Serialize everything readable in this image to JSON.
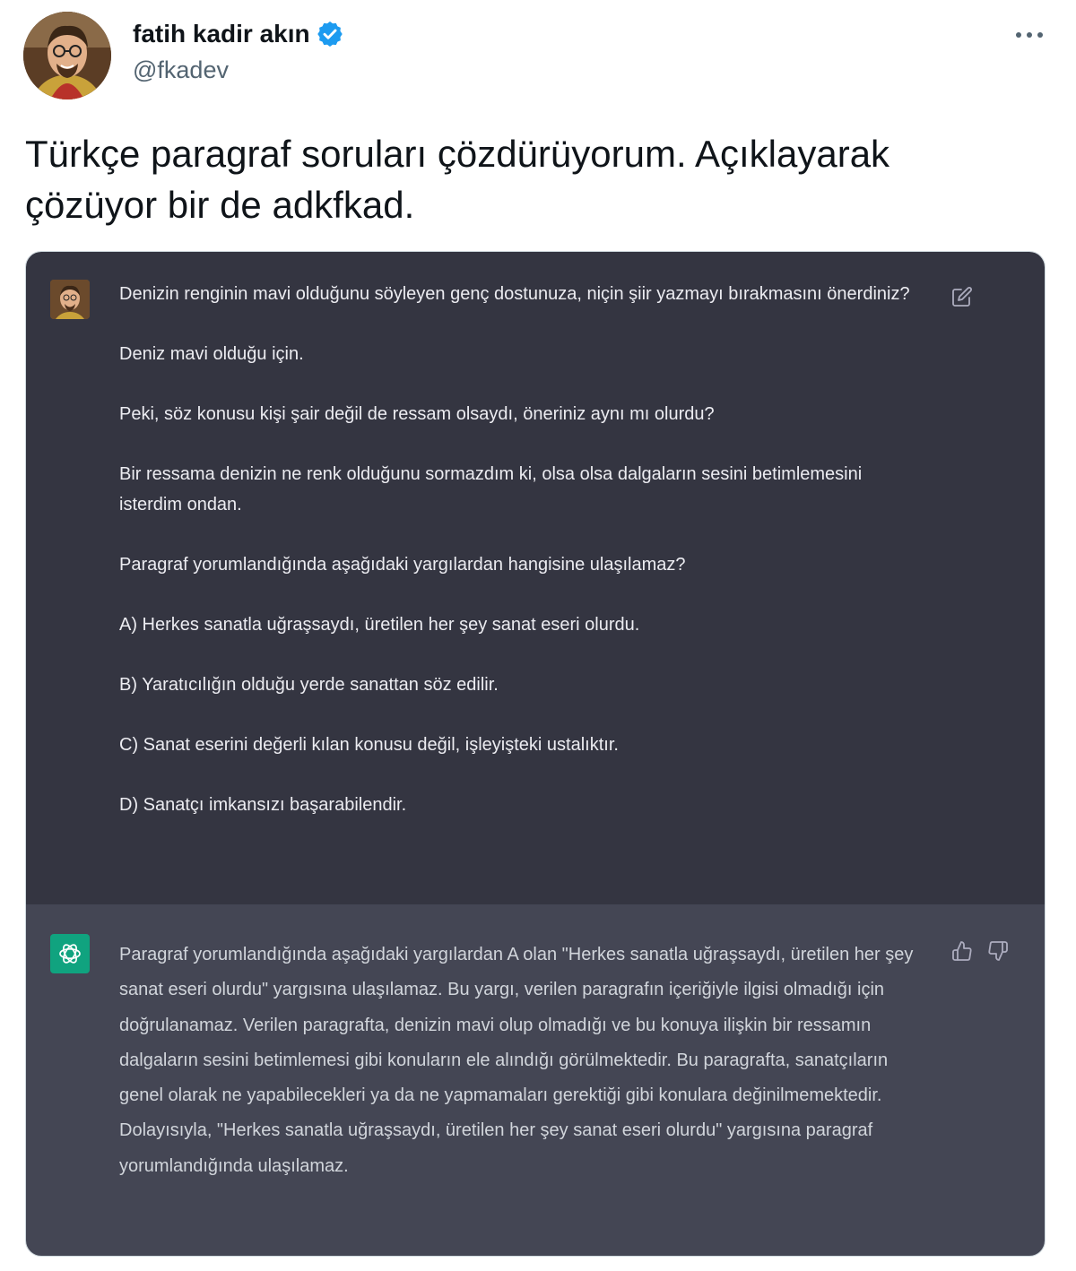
{
  "tweet": {
    "author": {
      "display_name": "fatih kadir akın",
      "handle": "@fkadev",
      "verified": true
    },
    "icons": {
      "verified": "verified-badge-icon",
      "more": "more-options-icon"
    },
    "text": "Türkçe paragraf soruları çözdürüyorum. Açıklayarak\nçözüyor bir de adkfkad."
  },
  "chat": {
    "user_message": {
      "paragraphs": [
        "Denizin renginin mavi olduğunu söyleyen genç dostunuza, niçin şiir yazmayı bırakmasını önerdiniz?",
        "Deniz mavi olduğu için.",
        "Peki, söz konusu kişi şair değil de ressam olsaydı, öneriniz aynı mı olurdu?",
        "Bir ressama denizin ne renk olduğunu sormazdım ki, olsa olsa dalgaların sesini betimlemesini isterdim ondan.",
        "Paragraf yorumlandığında aşağıdaki yargılardan hangisine ulaşılamaz?",
        "A) Herkes sanatla uğraşsaydı, üretilen her şey sanat eseri olurdu.",
        "B) Yaratıcılığın olduğu yerde sanattan söz edilir.",
        "C) Sanat eserini değerli kılan konusu değil, işleyişteki ustalıktır.",
        "D) Sanatçı imkansızı başarabilendir."
      ]
    },
    "assistant_message": {
      "text": "Paragraf yorumlandığında aşağıdaki yargılardan A olan \"Herkes sanatla uğraşsaydı, üretilen her şey sanat eseri olurdu\" yargısına ulaşılamaz. Bu yargı, verilen paragrafın içeriğiyle ilgisi olmadığı için doğrulanamaz. Verilen paragrafta, denizin mavi olup olmadığı ve bu konuya ilişkin bir ressamın dalgaların sesini betimlemesi gibi konuların ele alındığı görülmektedir. Bu paragrafta, sanatçıların genel olarak ne yapabilecekleri ya da ne yapmamaları gerektiği gibi konulara değinilmemektedir. Dolayısıyla, \"Herkes sanatla uğraşsaydı, üretilen her şey sanat eseri olurdu\" yargısına paragraf yorumlandığında ulaşılamaz."
    },
    "colors": {
      "user_bg": "#343541",
      "assistant_bg": "#444654",
      "gpt_brand": "#10a37f"
    },
    "icons": [
      "edit-icon",
      "thumb-up-icon",
      "thumb-down-icon",
      "openai-logo-icon"
    ]
  }
}
